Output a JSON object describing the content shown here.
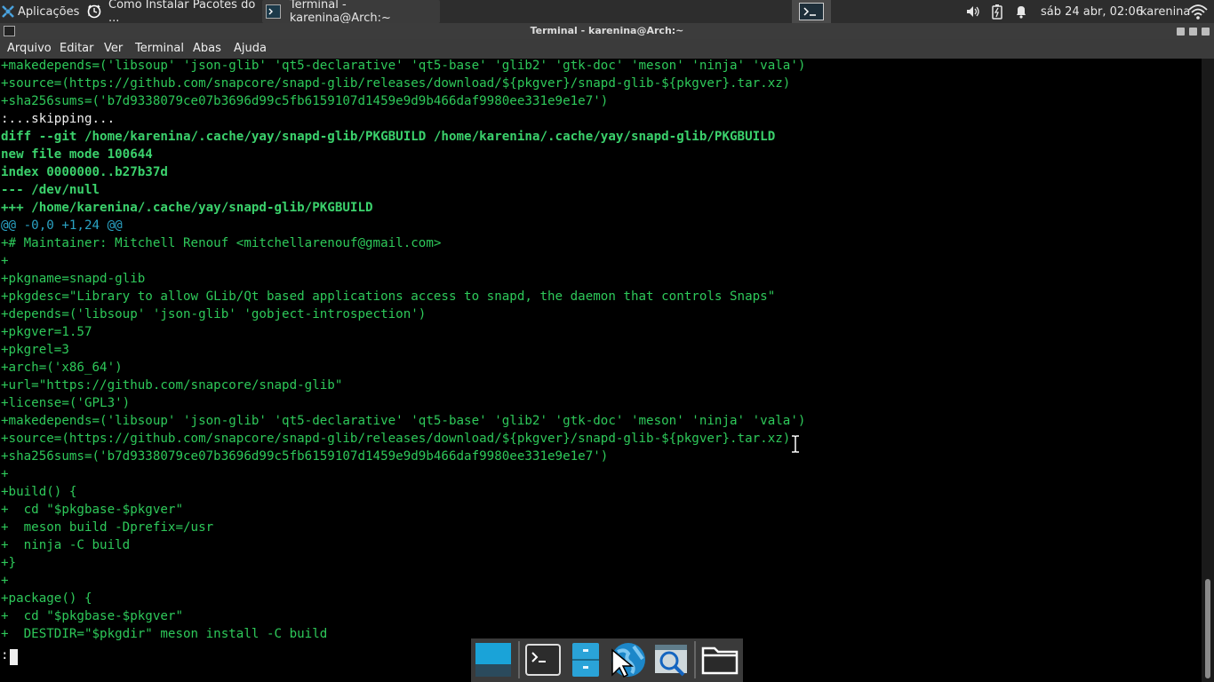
{
  "panel": {
    "apps_label": "Aplicações",
    "tasks": [
      {
        "label": "Como Instalar Pacotes do ..."
      },
      {
        "label": "Terminal - karenina@Arch:~"
      }
    ],
    "clock": "sáb 24 abr, 02:06",
    "user": "karenina"
  },
  "window": {
    "title": "Terminal - karenina@Arch:~",
    "menu": [
      "Arquivo",
      "Editar",
      "Ver",
      "Terminal",
      "Abas",
      "Ajuda"
    ]
  },
  "terminal": {
    "lines": [
      {
        "text": "+makedepends=('libsoup' 'json-glib' 'qt5-declarative' 'qt5-base' 'glib2' 'gtk-doc' 'meson' 'ninja' 'vala')",
        "style": "g"
      },
      {
        "text": "+source=(https://github.com/snapcore/snapd-glib/releases/download/${pkgver}/snapd-glib-${pkgver}.tar.xz)",
        "style": "g"
      },
      {
        "text": "+sha256sums=('b7d9338079ce07b3696d99c5fb6159107d1459e9d9b466daf9980ee331e9e1e7')",
        "style": "g"
      },
      {
        "text": ":...skipping...",
        "style": "w"
      },
      {
        "text": "diff --git /home/karenina/.cache/yay/snapd-glib/PKGBUILD /home/karenina/.cache/yay/snapd-glib/PKGBUILD",
        "style": "gb"
      },
      {
        "text": "new file mode 100644",
        "style": "gb"
      },
      {
        "text": "index 0000000..b27b37d",
        "style": "gb"
      },
      {
        "text": "--- /dev/null",
        "style": "gb"
      },
      {
        "text": "+++ /home/karenina/.cache/yay/snapd-glib/PKGBUILD",
        "style": "gb"
      },
      {
        "text": "@@ -0,0 +1,24 @@",
        "style": "c"
      },
      {
        "text": "+# Maintainer: Mitchell Renouf <mitchellarenouf@gmail.com>",
        "style": "g"
      },
      {
        "text": "+",
        "style": "g"
      },
      {
        "text": "+pkgname=snapd-glib",
        "style": "g"
      },
      {
        "text": "+pkgdesc=\"Library to allow GLib/Qt based applications access to snapd, the daemon that controls Snaps\"",
        "style": "g"
      },
      {
        "text": "+depends=('libsoup' 'json-glib' 'gobject-introspection')",
        "style": "g"
      },
      {
        "text": "+pkgver=1.57",
        "style": "g"
      },
      {
        "text": "+pkgrel=3",
        "style": "g"
      },
      {
        "text": "+arch=('x86_64')",
        "style": "g"
      },
      {
        "text": "+url=\"https://github.com/snapcore/snapd-glib\"",
        "style": "g"
      },
      {
        "text": "+license=('GPL3')",
        "style": "g"
      },
      {
        "text": "+makedepends=('libsoup' 'json-glib' 'qt5-declarative' 'qt5-base' 'glib2' 'gtk-doc' 'meson' 'ninja' 'vala')",
        "style": "g"
      },
      {
        "text": "+source=(https://github.com/snapcore/snapd-glib/releases/download/${pkgver}/snapd-glib-${pkgver}.tar.xz)",
        "style": "g"
      },
      {
        "text": "+sha256sums=('b7d9338079ce07b3696d99c5fb6159107d1459e9d9b466daf9980ee331e9e1e7')",
        "style": "g"
      },
      {
        "text": "+",
        "style": "g"
      },
      {
        "text": "+build() {",
        "style": "g"
      },
      {
        "text": "+  cd \"$pkgbase-$pkgver\"",
        "style": "g"
      },
      {
        "text": "+  meson build -Dprefix=/usr",
        "style": "g"
      },
      {
        "text": "+  ninja -C build",
        "style": "g"
      },
      {
        "text": "+}",
        "style": "g"
      },
      {
        "text": "+",
        "style": "g"
      },
      {
        "text": "+package() {",
        "style": "g"
      },
      {
        "text": "+  cd \"$pkgbase-$pkgver\"",
        "style": "g"
      },
      {
        "text": "+  DESTDIR=\"$pkgdir\" meson install -C build",
        "style": "g"
      }
    ],
    "prompt": ":"
  },
  "colors": {
    "terminal_bg": "#000000",
    "text_green": "#2ec95a",
    "hunk_cyan": "#2aa3c4",
    "panel_bg": "#2d2d2d"
  },
  "icons": {
    "apps": "xfce-mouse-icon",
    "task1": "firefox-icon",
    "task2": "terminal-icon",
    "dock": [
      "show-desktop-icon",
      "terminal-icon",
      "file-cabinet-icon",
      "web-browser-icon",
      "app-finder-icon",
      "folder-icon"
    ]
  }
}
